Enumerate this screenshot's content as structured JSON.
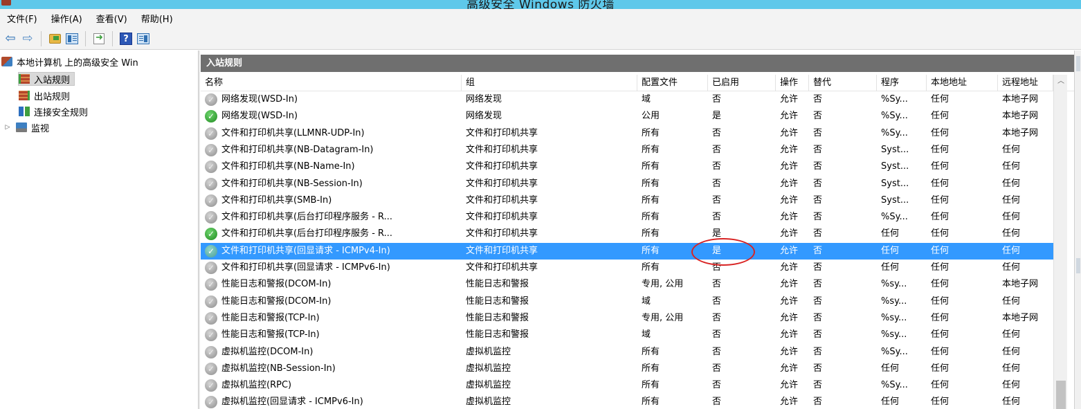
{
  "window": {
    "title": "高级安全 Windows 防火墙"
  },
  "menu": [
    "文件(F)",
    "操作(A)",
    "查看(V)",
    "帮助(H)"
  ],
  "toolbar": {
    "help_label": "?"
  },
  "tree": {
    "root": "本地计算机 上的高级安全 Win",
    "items": [
      "入站规则",
      "出站规则",
      "连接安全规则",
      "监视"
    ]
  },
  "panel": {
    "title": "入站规则"
  },
  "columns": [
    "名称",
    "组",
    "配置文件",
    "已启用",
    "操作",
    "替代",
    "程序",
    "本地地址",
    "远程地址"
  ],
  "rows": [
    {
      "status": "off",
      "name": "网络发现(WSD-In)",
      "group": "网络发现",
      "profile": "域",
      "enabled": "否",
      "action": "允许",
      "override": "否",
      "program": "%Sy...",
      "local": "任何",
      "remote": "本地子网"
    },
    {
      "status": "on",
      "name": "网络发现(WSD-In)",
      "group": "网络发现",
      "profile": "公用",
      "enabled": "是",
      "action": "允许",
      "override": "否",
      "program": "%Sy...",
      "local": "任何",
      "remote": "本地子网"
    },
    {
      "status": "off",
      "name": "文件和打印机共享(LLMNR-UDP-In)",
      "group": "文件和打印机共享",
      "profile": "所有",
      "enabled": "否",
      "action": "允许",
      "override": "否",
      "program": "%Sy...",
      "local": "任何",
      "remote": "本地子网"
    },
    {
      "status": "off",
      "name": "文件和打印机共享(NB-Datagram-In)",
      "group": "文件和打印机共享",
      "profile": "所有",
      "enabled": "否",
      "action": "允许",
      "override": "否",
      "program": "Syst...",
      "local": "任何",
      "remote": "任何"
    },
    {
      "status": "off",
      "name": "文件和打印机共享(NB-Name-In)",
      "group": "文件和打印机共享",
      "profile": "所有",
      "enabled": "否",
      "action": "允许",
      "override": "否",
      "program": "Syst...",
      "local": "任何",
      "remote": "任何"
    },
    {
      "status": "off",
      "name": "文件和打印机共享(NB-Session-In)",
      "group": "文件和打印机共享",
      "profile": "所有",
      "enabled": "否",
      "action": "允许",
      "override": "否",
      "program": "Syst...",
      "local": "任何",
      "remote": "任何"
    },
    {
      "status": "off",
      "name": "文件和打印机共享(SMB-In)",
      "group": "文件和打印机共享",
      "profile": "所有",
      "enabled": "否",
      "action": "允许",
      "override": "否",
      "program": "Syst...",
      "local": "任何",
      "remote": "任何"
    },
    {
      "status": "off",
      "name": "文件和打印机共享(后台打印程序服务 - R...",
      "group": "文件和打印机共享",
      "profile": "所有",
      "enabled": "否",
      "action": "允许",
      "override": "否",
      "program": "%Sy...",
      "local": "任何",
      "remote": "任何"
    },
    {
      "status": "on",
      "name": "文件和打印机共享(后台打印程序服务 - R...",
      "group": "文件和打印机共享",
      "profile": "所有",
      "enabled": "是",
      "action": "允许",
      "override": "否",
      "program": "任何",
      "local": "任何",
      "remote": "任何"
    },
    {
      "status": "sel",
      "selected": true,
      "name": "文件和打印机共享(回显请求 - ICMPv4-In)",
      "group": "文件和打印机共享",
      "profile": "所有",
      "enabled": "是",
      "action": "允许",
      "override": "否",
      "program": "任何",
      "local": "任何",
      "remote": "任何"
    },
    {
      "status": "off",
      "name": "文件和打印机共享(回显请求 - ICMPv6-In)",
      "group": "文件和打印机共享",
      "profile": "所有",
      "enabled": "否",
      "action": "允许",
      "override": "否",
      "program": "任何",
      "local": "任何",
      "remote": "任何"
    },
    {
      "status": "off",
      "name": "性能日志和警报(DCOM-In)",
      "group": "性能日志和警报",
      "profile": "专用, 公用",
      "enabled": "否",
      "action": "允许",
      "override": "否",
      "program": "%sy...",
      "local": "任何",
      "remote": "本地子网"
    },
    {
      "status": "off",
      "name": "性能日志和警报(DCOM-In)",
      "group": "性能日志和警报",
      "profile": "域",
      "enabled": "否",
      "action": "允许",
      "override": "否",
      "program": "%sy...",
      "local": "任何",
      "remote": "任何"
    },
    {
      "status": "off",
      "name": "性能日志和警报(TCP-In)",
      "group": "性能日志和警报",
      "profile": "专用, 公用",
      "enabled": "否",
      "action": "允许",
      "override": "否",
      "program": "%sy...",
      "local": "任何",
      "remote": "本地子网"
    },
    {
      "status": "off",
      "name": "性能日志和警报(TCP-In)",
      "group": "性能日志和警报",
      "profile": "域",
      "enabled": "否",
      "action": "允许",
      "override": "否",
      "program": "%sy...",
      "local": "任何",
      "remote": "任何"
    },
    {
      "status": "off",
      "name": "虚拟机监控(DCOM-In)",
      "group": "虚拟机监控",
      "profile": "所有",
      "enabled": "否",
      "action": "允许",
      "override": "否",
      "program": "%Sy...",
      "local": "任何",
      "remote": "任何"
    },
    {
      "status": "off",
      "name": "虚拟机监控(NB-Session-In)",
      "group": "虚拟机监控",
      "profile": "所有",
      "enabled": "否",
      "action": "允许",
      "override": "否",
      "program": "任何",
      "local": "任何",
      "remote": "任何"
    },
    {
      "status": "off",
      "name": "虚拟机监控(RPC)",
      "group": "虚拟机监控",
      "profile": "所有",
      "enabled": "否",
      "action": "允许",
      "override": "否",
      "program": "%Sy...",
      "local": "任何",
      "remote": "任何"
    },
    {
      "status": "off",
      "name": "虚拟机监控(回显请求 - ICMPv6-In)",
      "group": "虚拟机监控",
      "profile": "所有",
      "enabled": "否",
      "action": "允许",
      "override": "否",
      "program": "任何",
      "local": "任何",
      "remote": "任何"
    }
  ]
}
